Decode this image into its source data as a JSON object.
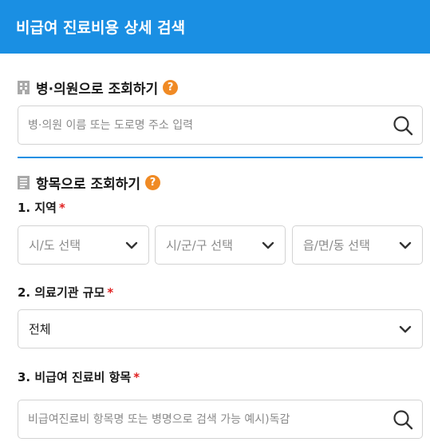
{
  "header": {
    "title": "비급여 진료비용 상세 검색"
  },
  "hospital_search": {
    "title": "병·의원으로 조회하기",
    "help": "?",
    "placeholder": "병·의원 이름 또는 도로명 주소 입력",
    "value": ""
  },
  "item_search": {
    "title": "항목으로 조회하기",
    "help": "?",
    "region": {
      "label": "1. 지역",
      "required": "*",
      "selects": [
        "시/도 선택",
        "시/군/구 선택",
        "읍/면/동 선택"
      ]
    },
    "facility_size": {
      "label": "2. 의료기관 규모",
      "required": "*",
      "selected": "전체"
    },
    "item": {
      "label": "3. 비급여 진료비 항목",
      "required": "*",
      "placeholder": "비급여진료비 항목명 또는 병명으로 검색 가능 예시)독감",
      "value": ""
    }
  },
  "colors": {
    "brand": "#1a8fe3",
    "help_badge": "#f08a24",
    "required": "#e02020"
  },
  "icons": [
    "hospital-building-icon",
    "help-icon",
    "search-icon",
    "document-list-icon",
    "chevron-down-icon"
  ]
}
